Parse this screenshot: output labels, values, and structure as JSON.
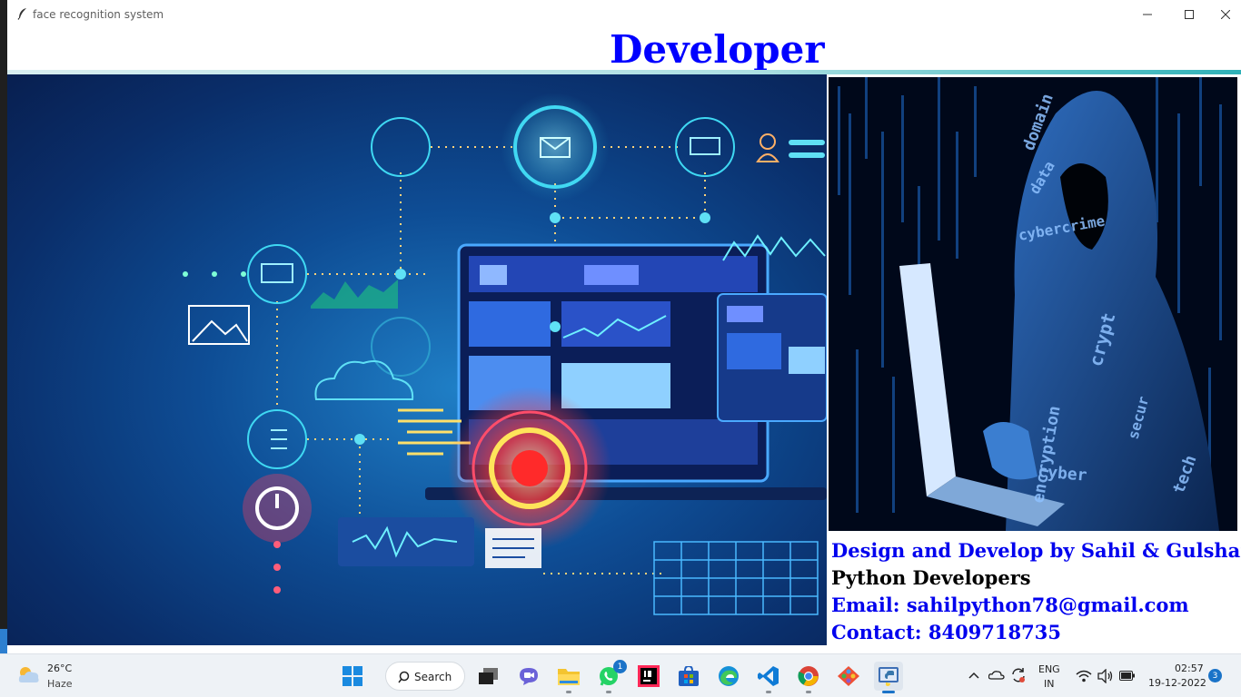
{
  "window": {
    "title": "face recognition system",
    "heading": "Developer"
  },
  "credits": {
    "line1": "Design and Develop by Sahil & Gulshan",
    "line2": "Python Developers",
    "line3": "Email: sahilpython78@gmail.com",
    "line4": "Contact: 8409718735"
  },
  "images": {
    "left": "technology-network-illustration",
    "right": "hooded-hacker-with-laptop",
    "hacker_words": [
      "domain",
      "cybercrime",
      "encryption",
      "crypt",
      "data",
      "cyber",
      "tech",
      "secur"
    ]
  },
  "taskbar": {
    "weather": {
      "temp": "26°C",
      "condition": "Haze",
      "icon": "weather-haze-icon"
    },
    "search_label": "Search",
    "apps": [
      {
        "name": "windows-start-icon"
      },
      {
        "name": "task-view-icon"
      },
      {
        "name": "teams-chat-icon"
      },
      {
        "name": "file-explorer-icon"
      },
      {
        "name": "whatsapp-icon",
        "badge": "1"
      },
      {
        "name": "intellij-idea-icon"
      },
      {
        "name": "microsoft-store-icon"
      },
      {
        "name": "edge-icon"
      },
      {
        "name": "vscode-icon"
      },
      {
        "name": "chrome-icon"
      },
      {
        "name": "git-icon"
      },
      {
        "name": "python-idle-icon"
      }
    ],
    "tray": {
      "lang_top": "ENG",
      "lang_bottom": "IN",
      "time": "02:57",
      "date": "19-12-2022",
      "notifications": "3"
    }
  },
  "colors": {
    "heading": "#0000ff",
    "credit_blue": "#0000ee",
    "credit_black": "#000000",
    "accent": "#1a73c8"
  }
}
